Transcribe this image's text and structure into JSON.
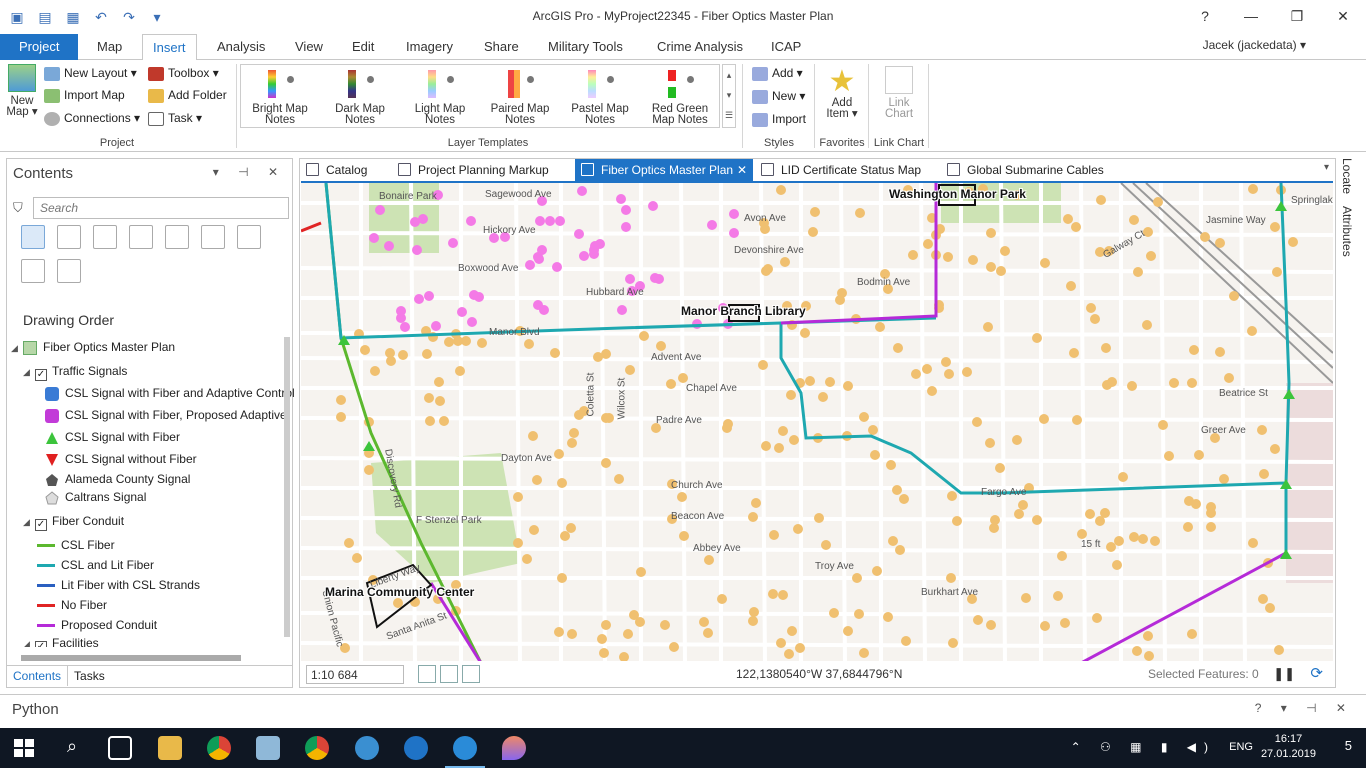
{
  "window": {
    "title": "ArcGIS Pro - MyProject22345 - Fiber Optics Master Plan",
    "help": "?",
    "minimize": "—",
    "maximize": "❐",
    "close": "✕"
  },
  "ribbon_tabs": [
    "Project",
    "Map",
    "Insert",
    "Analysis",
    "View",
    "Edit",
    "Imagery",
    "Share",
    "Military Tools",
    "Crime Analysis",
    "ICAP"
  ],
  "active_ribbon_tab": "Insert",
  "user": "Jacek (jackedata) ▾",
  "ribbon": {
    "project_group": {
      "label": "Project",
      "new_map": "New Map ▾",
      "new_layout": "New Layout ▾",
      "import_map": "Import Map",
      "connections": "Connections ▾",
      "toolbox": "Toolbox ▾",
      "add_folder": "Add Folder",
      "task": "Task ▾"
    },
    "layer_templates": {
      "label": "Layer Templates",
      "items": [
        "Bright Map Notes",
        "Dark Map Notes",
        "Light Map Notes",
        "Paired Map Notes",
        "Pastel Map Notes",
        "Red Green Map Notes"
      ]
    },
    "styles_group": {
      "label": "Styles",
      "add": "Add ▾",
      "new": "New ▾",
      "import": "Import"
    },
    "favorites_group": {
      "label": "Favorites",
      "add_item": "Add Item ▾"
    },
    "link_chart_group": {
      "label": "Link Chart",
      "link_chart": "Link Chart"
    }
  },
  "contents": {
    "title": "Contents",
    "search_placeholder": "Search",
    "drawing_order": "Drawing Order",
    "map_name": "Fiber Optics Master Plan",
    "traffic_signals": "Traffic Signals",
    "signal_items": [
      "CSL Signal with Fiber and Adaptive Control",
      "CSL Signal with Fiber, Proposed Adaptive",
      "CSL Signal with Fiber",
      "CSL Signal without Fiber",
      "Alameda County Signal",
      "Caltrans Signal"
    ],
    "fiber_conduit": "Fiber Conduit",
    "conduit_items": [
      "CSL Fiber",
      "CSL and Lit Fiber",
      "Lit Fiber with CSL Strands",
      "No Fiber",
      "Proposed Conduit"
    ],
    "facilities": "Facilities",
    "bottom_tabs": [
      "Contents",
      "Tasks"
    ]
  },
  "map_tabs": [
    "Catalog",
    "Project Planning Markup",
    "Fiber Optics Master Plan",
    "LID Certificate Status Map",
    "Global Submarine Cables"
  ],
  "active_map_tab": "Fiber Optics Master Plan",
  "map": {
    "poi_labels": [
      "Washington Manor Park",
      "Manor Branch Library",
      "Marina Community Center"
    ],
    "park_labels": [
      "Bonaire Park",
      "F Stenzel Park"
    ],
    "street_labels": [
      "Sagewood Ave",
      "Hickory Ave",
      "Boxwood Ave",
      "Hubbard Ave",
      "Manor Blvd",
      "Avon Ave",
      "Devonshire Ave",
      "Bodmin Ave",
      "Advent Ave",
      "Chapel Ave",
      "Padre Ave",
      "Dayton Ave",
      "Church Ave",
      "Beacon Ave",
      "Abbey Ave",
      "Troy Ave",
      "Burkhart Ave",
      "Fargo Ave",
      "Beatrice St",
      "Greer Ave",
      "Discovery Rd",
      "Liberty Way",
      "Santa Anita St",
      "Jasmine Way",
      "Galway Ct",
      "Springlake",
      "Union Pacific",
      "Wilcox St",
      "Coletta St"
    ],
    "elevation_label": "15 ft"
  },
  "status": {
    "scale": "1:10 684",
    "coordinates": "122,1380540°W 37,6844796°N",
    "selected_features": "Selected Features: 0"
  },
  "side_tabs": [
    "Locate",
    "Attributes"
  ],
  "python_pane": "Python",
  "taskbar": {
    "time": "16:17",
    "date": "27.01.2019",
    "language": "ENG",
    "notifications": "5"
  },
  "colors": {
    "accent": "#1f73c6",
    "csl_fiber": "#5cb82e",
    "csl_and_lit": "#1ea8b0",
    "lit_fiber": "#2a5fc0",
    "no_fiber": "#e02424",
    "proposed_conduit": "#b52ad8",
    "signal_dot": "#f0c070",
    "proposed_dot": "#f47ae6"
  }
}
